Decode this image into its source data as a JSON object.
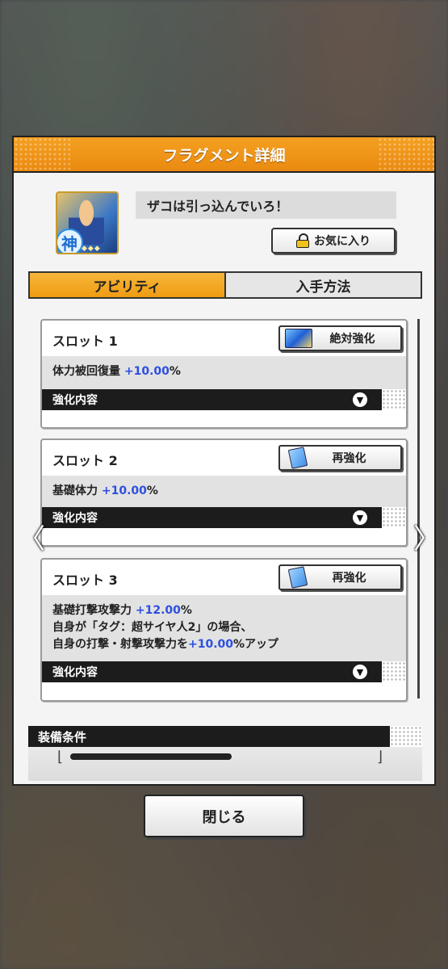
{
  "dialog": {
    "title": "フラグメント詳細",
    "fragment_name": "ザコは引っ込んでいろ！",
    "thumb_badge": "神",
    "favorite_label": "お気に入り",
    "tabs": [
      {
        "label": "アビリティ",
        "active": true
      },
      {
        "label": "入手方法",
        "active": false
      }
    ]
  },
  "slots": [
    {
      "title": "スロット 1",
      "button_label": "絶対強化",
      "button_icon": "card-icon",
      "lines": [
        {
          "pre": "体力被回復量 ",
          "value": "+10.00",
          "post": "%"
        }
      ],
      "bar_label": "強化内容"
    },
    {
      "title": "スロット 2",
      "button_label": "再強化",
      "button_icon": "note-icon",
      "lines": [
        {
          "pre": "基礎体力 ",
          "value": "+10.00",
          "post": "%"
        }
      ],
      "bar_label": "強化内容"
    },
    {
      "title": "スロット 3",
      "button_label": "再強化",
      "button_icon": "note-icon",
      "lines": [
        {
          "pre": "基礎打撃攻撃力 ",
          "value": "+12.00",
          "post": "%"
        },
        {
          "pre": "自身が「タグ：超サイヤ人2」の場合、",
          "value": "",
          "post": ""
        },
        {
          "pre": "自身の打撃・射撃攻撃力を",
          "value": "+10.00",
          "post": "%アップ"
        }
      ],
      "bar_label": "強化内容"
    }
  ],
  "equip": {
    "label": "装備条件"
  },
  "close_label": "閉じる",
  "nav": {
    "left_arrow": "〈",
    "right_arrow": "〉"
  },
  "colors": {
    "accent_orange": "#ef9c12",
    "value_blue": "#2c4fe0",
    "dark_bar": "#1c1c1c"
  }
}
